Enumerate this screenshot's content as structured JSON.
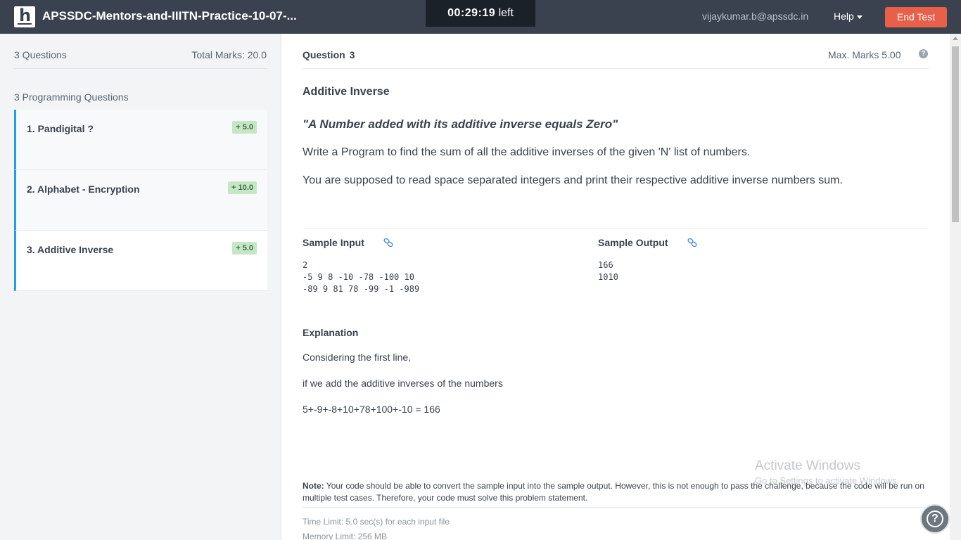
{
  "header": {
    "logo": "h",
    "contest_title": "APSSDC-Mentors-and-IIITN-Practice-10-07-...",
    "timer": "00:29:19",
    "timer_suffix": "left",
    "email": "vijaykumar.b@apssdc.in",
    "help_label": "Help",
    "end_test_label": "End Test"
  },
  "sidebar": {
    "questions_count": "3 Questions",
    "total_marks": "Total Marks: 20.0",
    "programming_heading": "3 Programming Questions",
    "items": [
      {
        "label": "1. Pandigital ?",
        "badge": "+ 5.0"
      },
      {
        "label": "2. Alphabet - Encryption",
        "badge": "+ 10.0"
      },
      {
        "label": "3. Additive Inverse",
        "badge": "+ 5.0"
      }
    ]
  },
  "question": {
    "label": "Question",
    "number": "3",
    "max_marks": "Max. Marks 5.00",
    "help_icon": "question-circle-icon",
    "title": "Additive Inverse",
    "quote": "\"A Number added with its additive inverse equals Zero\"",
    "paragraph1": "Write a Program to find the sum of all the additive inverses of the given 'N' list of numbers.",
    "paragraph2": "You are supposed to read space separated integers and print their respective additive inverse numbers sum.",
    "sample_input_label": "Sample Input",
    "sample_output_label": "Sample Output",
    "sample_input": "2\n-5 9 8 -10 -78 -100 10\n-89 9 81 78 -99 -1 -989",
    "sample_output": "166\n1010",
    "explanation_label": "Explanation",
    "explanation_lines": [
      "Considering the first line,",
      "if we add the additive inverses of the numbers",
      "5+-9+-8+10+78+100+-10 = 166"
    ],
    "note_label": "Note:",
    "note_text": " Your code should be able to convert the sample input into the sample output. However, this is not enough to pass the challenge, because the code will be run on multiple test cases. Therefore, your code must solve this problem statement.",
    "time_limit": "Time Limit: 5.0 sec(s) for each input file",
    "memory_limit": "Memory Limit: 256 MB"
  },
  "watermark": {
    "line1": "Activate Windows",
    "line2": "Go to Settings to activate Windows."
  },
  "colors": {
    "header_bg": "#39424e",
    "end_test_bg": "#e9604a",
    "active_border": "#1f9eea",
    "badge_bg": "#c6e7c6"
  }
}
